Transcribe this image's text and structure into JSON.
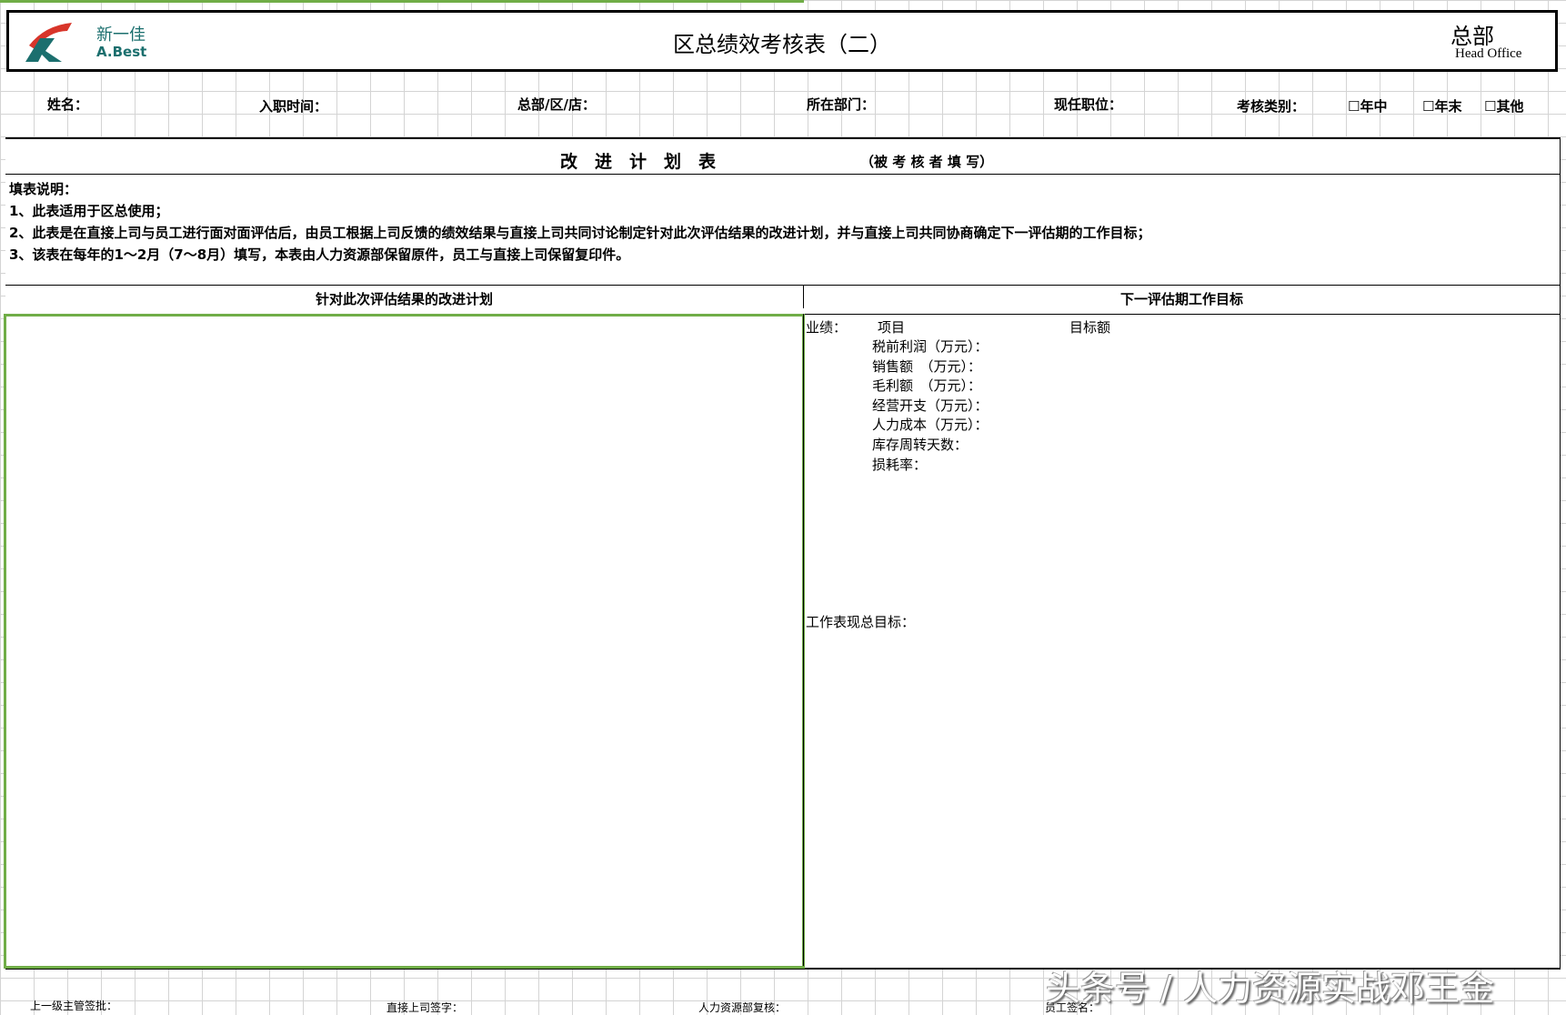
{
  "header": {
    "logo_cn": "新一佳",
    "logo_en": "A.Best",
    "title": "区总绩效考核表（二）",
    "office_cn": "总部",
    "office_en": "Head Office"
  },
  "info": {
    "name": "姓名：",
    "join_date": "入职时间：",
    "location": "总部/区/店：",
    "department": "所在部门：",
    "position": "现任职位：",
    "review_type": "考核类别：",
    "options": [
      "年中",
      "年末",
      "其他"
    ]
  },
  "plan": {
    "title": "改　进　计　划　表",
    "subtitle": "（被 考 核 者 填 写）",
    "instructions_title": "填表说明：",
    "instructions": [
      "1、此表适用于区总使用；",
      "2、此表是在直接上司与员工进行面对面评估后，由员工根据上司反馈的绩效结果与直接上司共同讨论制定针对此次评估结果的改进计划，并与直接上司共同协商确定下一评估期的工作目标；",
      "3、该表在每年的1～2月（7～8月）填写，本表由人力资源部保留原件，员工与直接上司保留复印件。"
    ],
    "left_header": "针对此次评估结果的改进计划",
    "right_header": "下一评估期工作目标",
    "perf_label": "业绩：",
    "item_col": "项目",
    "target_col": "目标额",
    "items": [
      "税前利润（万元）：",
      "销售额　（万元）：",
      "毛利额　（万元）：",
      "经营开支（万元）：",
      "人力成本（万元）：",
      "库存周转天数：",
      "损耗率："
    ],
    "work_goal": "工作表现总目标："
  },
  "signatures": [
    "上一级主管签批：",
    "直接上司签字：",
    "人力资源部复核：",
    "员工签名："
  ],
  "watermark": "头条号 / 人力资源实战邓王金"
}
